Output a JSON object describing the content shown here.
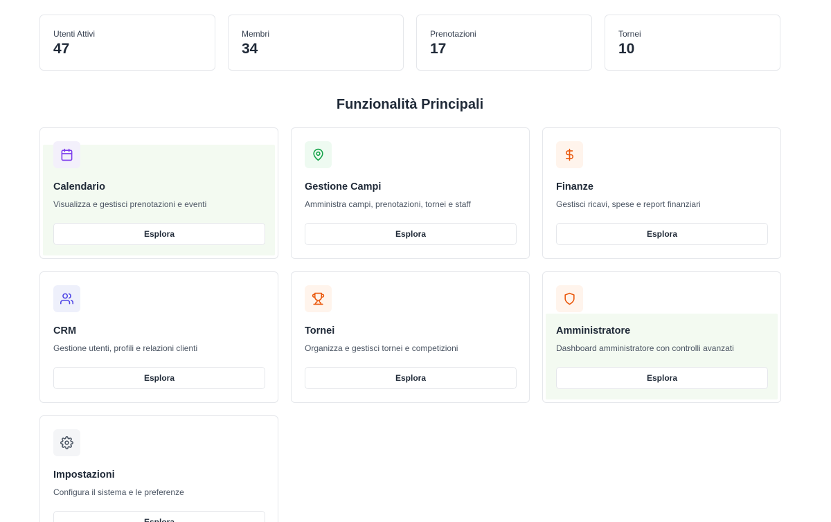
{
  "stats": [
    {
      "label": "Utenti Attivi",
      "value": "47"
    },
    {
      "label": "Membri",
      "value": "34"
    },
    {
      "label": "Prenotazioni",
      "value": "17"
    },
    {
      "label": "Tornei",
      "value": "10"
    }
  ],
  "section_title": "Funzionalità Principali",
  "features": [
    {
      "icon": "calendar-icon",
      "icon_color": "#7c3aed",
      "icon_bg": "#f3f0fb",
      "title": "Calendario",
      "description": "Visualizza e gestisci prenotazioni e eventi",
      "button": "Esplora"
    },
    {
      "icon": "map-pin-icon",
      "icon_color": "#16a34a",
      "icon_bg": "#eefaf1",
      "title": "Gestione Campi",
      "description": "Amministra campi, prenotazioni, tornei e staff",
      "button": "Esplora"
    },
    {
      "icon": "dollar-icon",
      "icon_color": "#ea580c",
      "icon_bg": "#fff4ec",
      "title": "Finanze",
      "description": "Gestisci ricavi, spese e report finanziari",
      "button": "Esplora"
    },
    {
      "icon": "users-icon",
      "icon_color": "#4f46e5",
      "icon_bg": "#eef0fb",
      "title": "CRM",
      "description": "Gestione utenti, profili e relazioni clienti",
      "button": "Esplora"
    },
    {
      "icon": "trophy-icon",
      "icon_color": "#ea580c",
      "icon_bg": "#fff4ec",
      "title": "Tornei",
      "description": "Organizza e gestisci tornei e competizioni",
      "button": "Esplora"
    },
    {
      "icon": "shield-icon",
      "icon_color": "#ea580c",
      "icon_bg": "#fff4ec",
      "title": "Amministratore",
      "description": "Dashboard amministratore con controlli avanzati",
      "button": "Esplora"
    },
    {
      "icon": "gear-icon",
      "icon_color": "#4b5563",
      "icon_bg": "#f4f5f7",
      "title": "Impostazioni",
      "description": "Configura il sistema e le preferenze",
      "button": "Esplora"
    }
  ]
}
